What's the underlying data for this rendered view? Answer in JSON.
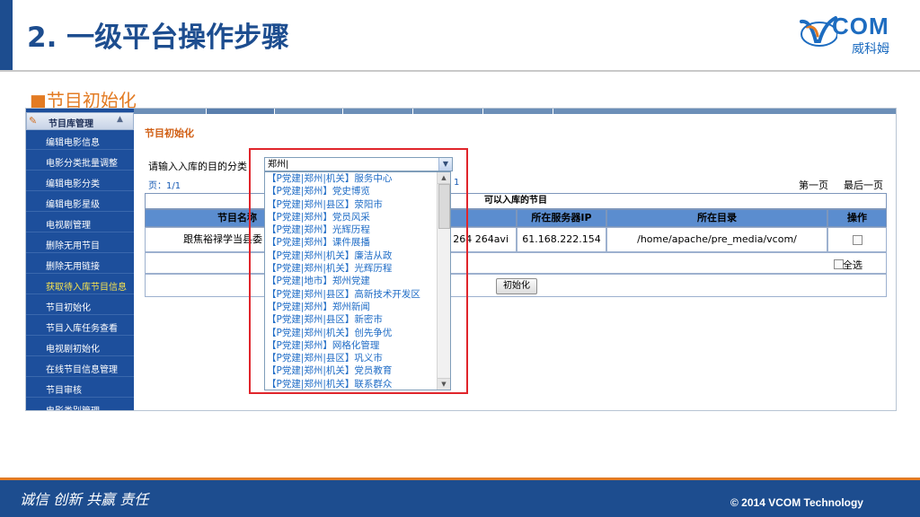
{
  "slide": {
    "title": "2. 一级平台操作步骤",
    "subtitle": "■节目初始化",
    "logo_text": "COM",
    "logo_cn": "威科姆"
  },
  "sidebar": {
    "header": "节目库管理",
    "items": [
      {
        "label": "编辑电影信息"
      },
      {
        "label": "电影分类批量调整"
      },
      {
        "label": "编辑电影分类"
      },
      {
        "label": "编辑电影星级"
      },
      {
        "label": "电视剧管理"
      },
      {
        "label": "删除无用节目"
      },
      {
        "label": "删除无用链接"
      },
      {
        "label": "获取待入库节目信息",
        "highlight": true
      },
      {
        "label": "节目初始化"
      },
      {
        "label": "节目入库任务查看"
      },
      {
        "label": "电视剧初始化"
      },
      {
        "label": "在线节目信息管理"
      },
      {
        "label": "节目审核"
      },
      {
        "label": "电影类别管理"
      }
    ]
  },
  "content": {
    "title": "节目初始化",
    "prompt": "请输入入库的目的分类",
    "select_value": "郑州|",
    "page": "页：1/1",
    "page_count": "1",
    "first_page": "第一页",
    "last_page": "最后一页",
    "table_caption": "可以入库的节目",
    "columns": [
      "节目名称",
      "所在服务器IP",
      "所在目录",
      "操作"
    ],
    "row": {
      "name": "跟焦裕禄学当县委",
      "file": "264 264avi",
      "ip": "61.168.222.154",
      "dir": "/home/apache/pre_media/vcom/"
    },
    "select_all": "全选",
    "init_button": "初始化"
  },
  "dropdown": {
    "options": [
      "【P党建|郑州|机关】服务中心",
      "【P党建|郑州】党史博览",
      "【P党建|郑州|县区】荥阳市",
      "【P党建|郑州】党员风采",
      "【P党建|郑州】光辉历程",
      "【P党建|郑州】课件展播",
      "【P党建|郑州|机关】廉洁从政",
      "【P党建|郑州|机关】光辉历程",
      "【P党建|地市】郑州党建",
      "【P党建|郑州|县区】高新技术开发区",
      "【P党建|郑州】郑州新闻",
      "【P党建|郑州|县区】新密市",
      "【P党建|郑州|机关】创先争优",
      "【P党建|郑州】网格化管理",
      "【P党建|郑州|县区】巩义市",
      "【P党建|郑州|机关】党员教育",
      "【P党建|郑州|机关】联系群众"
    ]
  },
  "footer": {
    "slogan": "诚信  创新  共赢   责任",
    "copyright": "© 2014 VCOM Technology"
  },
  "colors": {
    "brand_blue": "#1d4d8f",
    "accent_orange": "#e37b23",
    "highlight_red": "#e0252b",
    "sidebar_blue": "#1d4f9c",
    "table_header": "#5b8dcf"
  }
}
